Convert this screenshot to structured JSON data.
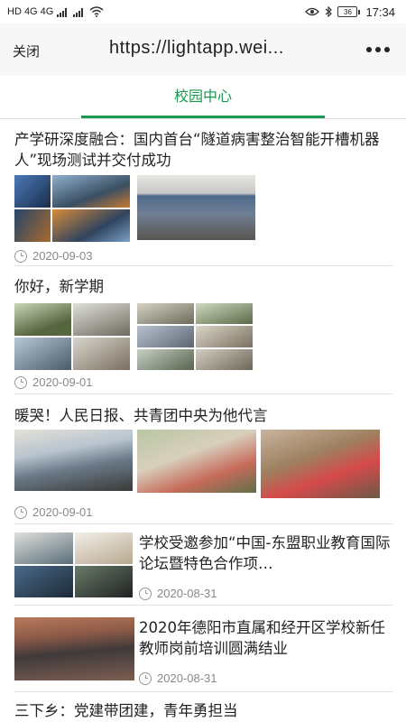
{
  "status_bar": {
    "left_text": "HD 4G 4G",
    "battery": "36",
    "time": "17:34"
  },
  "topbar": {
    "close_label": "关闭",
    "url": "https://lightapp.wei..."
  },
  "tabs": [
    {
      "label": "校园中心"
    }
  ],
  "articles": [
    {
      "title": "产学研深度融合：国内首台“隧道病害整治智能开槽机器人”现场测试并交付成功",
      "date": "2020-09-03"
    },
    {
      "title": "你好，新学期",
      "date": "2020-09-01"
    },
    {
      "title": "暖哭！人民日报、共青团中央为他代言",
      "date": "2020-09-01"
    },
    {
      "title": "学校受邀参加“中国-东盟职业教育国际论坛暨特色合作项…",
      "date": "2020-08-31"
    },
    {
      "title": "2020年德阳市直属和经开区学校新任教师岗前培训圆满结业",
      "date": "2020-08-31"
    },
    {
      "title": "三下乡：党建带团建，青年勇担当",
      "date": ""
    }
  ],
  "colors": {
    "accent": "#1b9950",
    "date_text": "#888888"
  }
}
